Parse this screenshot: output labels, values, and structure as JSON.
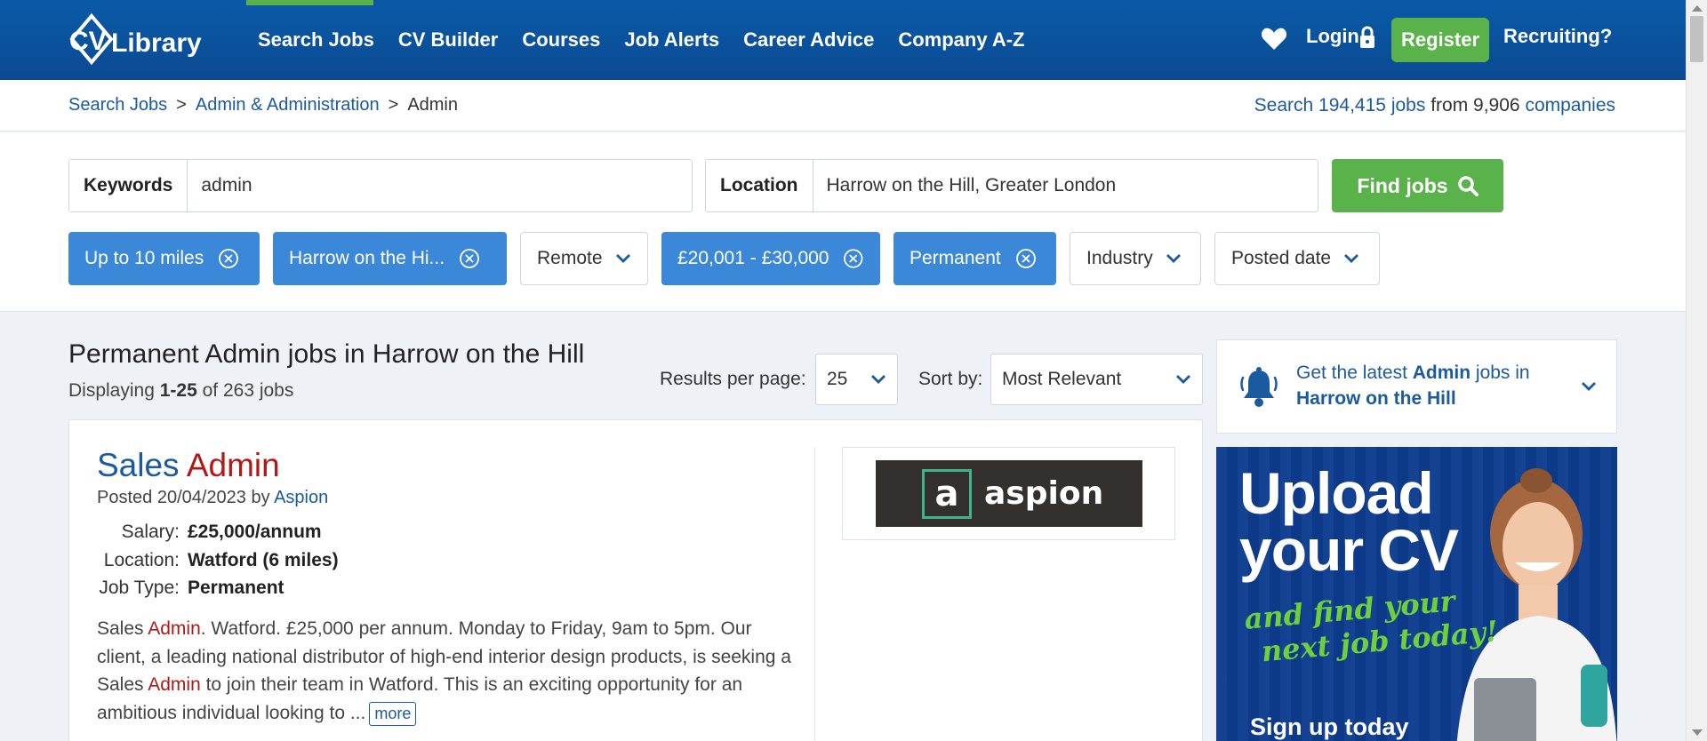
{
  "header": {
    "logo_text": "CV Library",
    "nav": [
      "Search Jobs",
      "CV Builder",
      "Courses",
      "Job Alerts",
      "Career Advice",
      "Company A-Z"
    ],
    "login": "Login",
    "register": "Register",
    "recruiting": "Recruiting?",
    "brand_color": "#0b4f9a",
    "accent_color": "#5ab24a"
  },
  "breadcrumb": {
    "items": [
      "Search Jobs",
      "Admin & Administration",
      "Admin"
    ],
    "separator": ">"
  },
  "site_stats": {
    "search_word": "Search",
    "job_count": "194,415",
    "jobs_word": "jobs",
    "from_word": "from",
    "company_count": "9,906",
    "companies_word": "companies"
  },
  "search": {
    "keywords_label": "Keywords",
    "keywords_value": "admin",
    "location_label": "Location",
    "location_value": "Harrow on the Hill, Greater London",
    "find_button": "Find jobs"
  },
  "filters": [
    {
      "label": "Up to 10 miles",
      "active": true
    },
    {
      "label": "Harrow on the Hi...",
      "active": true
    },
    {
      "label": "Remote",
      "active": false
    },
    {
      "label": "£20,001 - £30,000",
      "active": true
    },
    {
      "label": "Permanent",
      "active": true
    },
    {
      "label": "Industry",
      "active": false
    },
    {
      "label": "Posted date",
      "active": false
    }
  ],
  "results": {
    "title": "Permanent Admin jobs in Harrow on the Hill",
    "displaying_word": "Displaying",
    "range": "1-25",
    "of_text": "of 263 jobs",
    "per_page_label": "Results per page:",
    "per_page_value": "25",
    "sort_label": "Sort by:",
    "sort_value": "Most Relevant"
  },
  "job": {
    "title_part1": "Sales",
    "title_part2": "Admin",
    "posted_prefix": "Posted 20/04/2023 by",
    "company": "Aspion",
    "salary_label": "Salary:",
    "salary": "£25,000/annum",
    "location_label": "Location:",
    "location": "Watford (6 miles)",
    "type_label": "Job Type:",
    "type": "Permanent",
    "desc_1": "Sales ",
    "desc_hl1": "Admin",
    "desc_2": ". Watford. £25,000 per annum. Monday to Friday, 9am to 5pm. Our client, a leading national distributor of high-end interior design products, is seeking a Sales ",
    "desc_hl2": "Admin",
    "desc_3": " to join their team in Watford. This is an exciting opportunity for an ambitious individual looking to ...",
    "more": "more",
    "logo_text": "aspion",
    "logo_letter": "a"
  },
  "alert": {
    "text_1": "Get the latest ",
    "text_bold1": "Admin",
    "text_2": " jobs in ",
    "text_bold2": "Harrow on the Hill"
  },
  "ad": {
    "line1": "Upload",
    "line2": "your CV",
    "line3": "and find your",
    "line4": "next job today!",
    "cta": "Sign up today"
  }
}
